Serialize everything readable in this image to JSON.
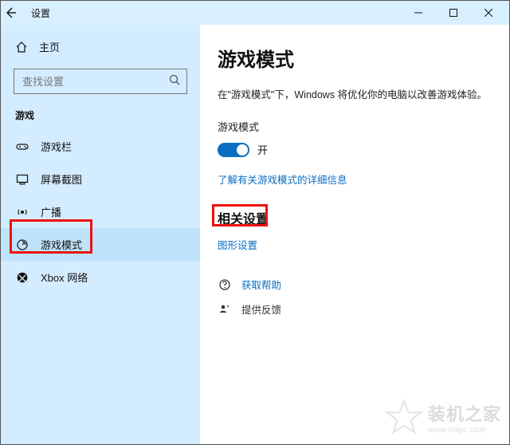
{
  "titlebar": {
    "title": "设置"
  },
  "sidebar": {
    "home": "主页",
    "search_placeholder": "查找设置",
    "section": "游戏",
    "items": [
      {
        "label": "游戏栏"
      },
      {
        "label": "屏幕截图"
      },
      {
        "label": "广播"
      },
      {
        "label": "游戏模式"
      },
      {
        "label": "Xbox 网络"
      }
    ]
  },
  "content": {
    "h1": "游戏模式",
    "desc": "在\"游戏模式\"下，Windows 将优化你的电脑以改善游戏体验。",
    "toggle_label": "游戏模式",
    "toggle_state": "开",
    "learn_more": "了解有关游戏模式的详细信息",
    "related_h2": "相关设置",
    "graphics_link": "图形设置",
    "help": "获取帮助",
    "feedback": "提供反馈"
  },
  "watermark": {
    "cn": "装机之家",
    "en": "www.lotpc.com"
  }
}
